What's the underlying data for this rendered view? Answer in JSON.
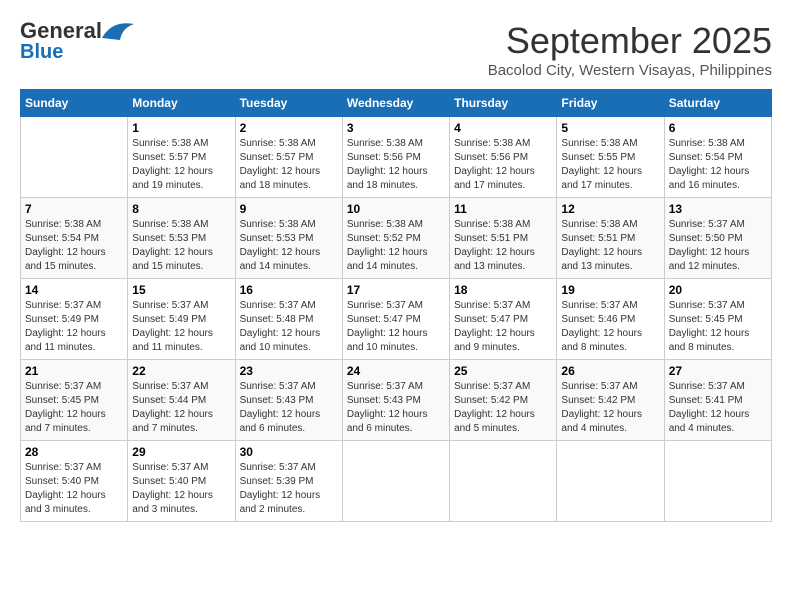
{
  "header": {
    "logo_line1": "General",
    "logo_line2": "Blue",
    "month": "September 2025",
    "location": "Bacolod City, Western Visayas, Philippines"
  },
  "weekdays": [
    "Sunday",
    "Monday",
    "Tuesday",
    "Wednesday",
    "Thursday",
    "Friday",
    "Saturday"
  ],
  "weeks": [
    [
      {
        "day": "",
        "info": ""
      },
      {
        "day": "1",
        "info": "Sunrise: 5:38 AM\nSunset: 5:57 PM\nDaylight: 12 hours\nand 19 minutes."
      },
      {
        "day": "2",
        "info": "Sunrise: 5:38 AM\nSunset: 5:57 PM\nDaylight: 12 hours\nand 18 minutes."
      },
      {
        "day": "3",
        "info": "Sunrise: 5:38 AM\nSunset: 5:56 PM\nDaylight: 12 hours\nand 18 minutes."
      },
      {
        "day": "4",
        "info": "Sunrise: 5:38 AM\nSunset: 5:56 PM\nDaylight: 12 hours\nand 17 minutes."
      },
      {
        "day": "5",
        "info": "Sunrise: 5:38 AM\nSunset: 5:55 PM\nDaylight: 12 hours\nand 17 minutes."
      },
      {
        "day": "6",
        "info": "Sunrise: 5:38 AM\nSunset: 5:54 PM\nDaylight: 12 hours\nand 16 minutes."
      }
    ],
    [
      {
        "day": "7",
        "info": "Sunrise: 5:38 AM\nSunset: 5:54 PM\nDaylight: 12 hours\nand 15 minutes."
      },
      {
        "day": "8",
        "info": "Sunrise: 5:38 AM\nSunset: 5:53 PM\nDaylight: 12 hours\nand 15 minutes."
      },
      {
        "day": "9",
        "info": "Sunrise: 5:38 AM\nSunset: 5:53 PM\nDaylight: 12 hours\nand 14 minutes."
      },
      {
        "day": "10",
        "info": "Sunrise: 5:38 AM\nSunset: 5:52 PM\nDaylight: 12 hours\nand 14 minutes."
      },
      {
        "day": "11",
        "info": "Sunrise: 5:38 AM\nSunset: 5:51 PM\nDaylight: 12 hours\nand 13 minutes."
      },
      {
        "day": "12",
        "info": "Sunrise: 5:38 AM\nSunset: 5:51 PM\nDaylight: 12 hours\nand 13 minutes."
      },
      {
        "day": "13",
        "info": "Sunrise: 5:37 AM\nSunset: 5:50 PM\nDaylight: 12 hours\nand 12 minutes."
      }
    ],
    [
      {
        "day": "14",
        "info": "Sunrise: 5:37 AM\nSunset: 5:49 PM\nDaylight: 12 hours\nand 11 minutes."
      },
      {
        "day": "15",
        "info": "Sunrise: 5:37 AM\nSunset: 5:49 PM\nDaylight: 12 hours\nand 11 minutes."
      },
      {
        "day": "16",
        "info": "Sunrise: 5:37 AM\nSunset: 5:48 PM\nDaylight: 12 hours\nand 10 minutes."
      },
      {
        "day": "17",
        "info": "Sunrise: 5:37 AM\nSunset: 5:47 PM\nDaylight: 12 hours\nand 10 minutes."
      },
      {
        "day": "18",
        "info": "Sunrise: 5:37 AM\nSunset: 5:47 PM\nDaylight: 12 hours\nand 9 minutes."
      },
      {
        "day": "19",
        "info": "Sunrise: 5:37 AM\nSunset: 5:46 PM\nDaylight: 12 hours\nand 8 minutes."
      },
      {
        "day": "20",
        "info": "Sunrise: 5:37 AM\nSunset: 5:45 PM\nDaylight: 12 hours\nand 8 minutes."
      }
    ],
    [
      {
        "day": "21",
        "info": "Sunrise: 5:37 AM\nSunset: 5:45 PM\nDaylight: 12 hours\nand 7 minutes."
      },
      {
        "day": "22",
        "info": "Sunrise: 5:37 AM\nSunset: 5:44 PM\nDaylight: 12 hours\nand 7 minutes."
      },
      {
        "day": "23",
        "info": "Sunrise: 5:37 AM\nSunset: 5:43 PM\nDaylight: 12 hours\nand 6 minutes."
      },
      {
        "day": "24",
        "info": "Sunrise: 5:37 AM\nSunset: 5:43 PM\nDaylight: 12 hours\nand 6 minutes."
      },
      {
        "day": "25",
        "info": "Sunrise: 5:37 AM\nSunset: 5:42 PM\nDaylight: 12 hours\nand 5 minutes."
      },
      {
        "day": "26",
        "info": "Sunrise: 5:37 AM\nSunset: 5:42 PM\nDaylight: 12 hours\nand 4 minutes."
      },
      {
        "day": "27",
        "info": "Sunrise: 5:37 AM\nSunset: 5:41 PM\nDaylight: 12 hours\nand 4 minutes."
      }
    ],
    [
      {
        "day": "28",
        "info": "Sunrise: 5:37 AM\nSunset: 5:40 PM\nDaylight: 12 hours\nand 3 minutes."
      },
      {
        "day": "29",
        "info": "Sunrise: 5:37 AM\nSunset: 5:40 PM\nDaylight: 12 hours\nand 3 minutes."
      },
      {
        "day": "30",
        "info": "Sunrise: 5:37 AM\nSunset: 5:39 PM\nDaylight: 12 hours\nand 2 minutes."
      },
      {
        "day": "",
        "info": ""
      },
      {
        "day": "",
        "info": ""
      },
      {
        "day": "",
        "info": ""
      },
      {
        "day": "",
        "info": ""
      }
    ]
  ]
}
